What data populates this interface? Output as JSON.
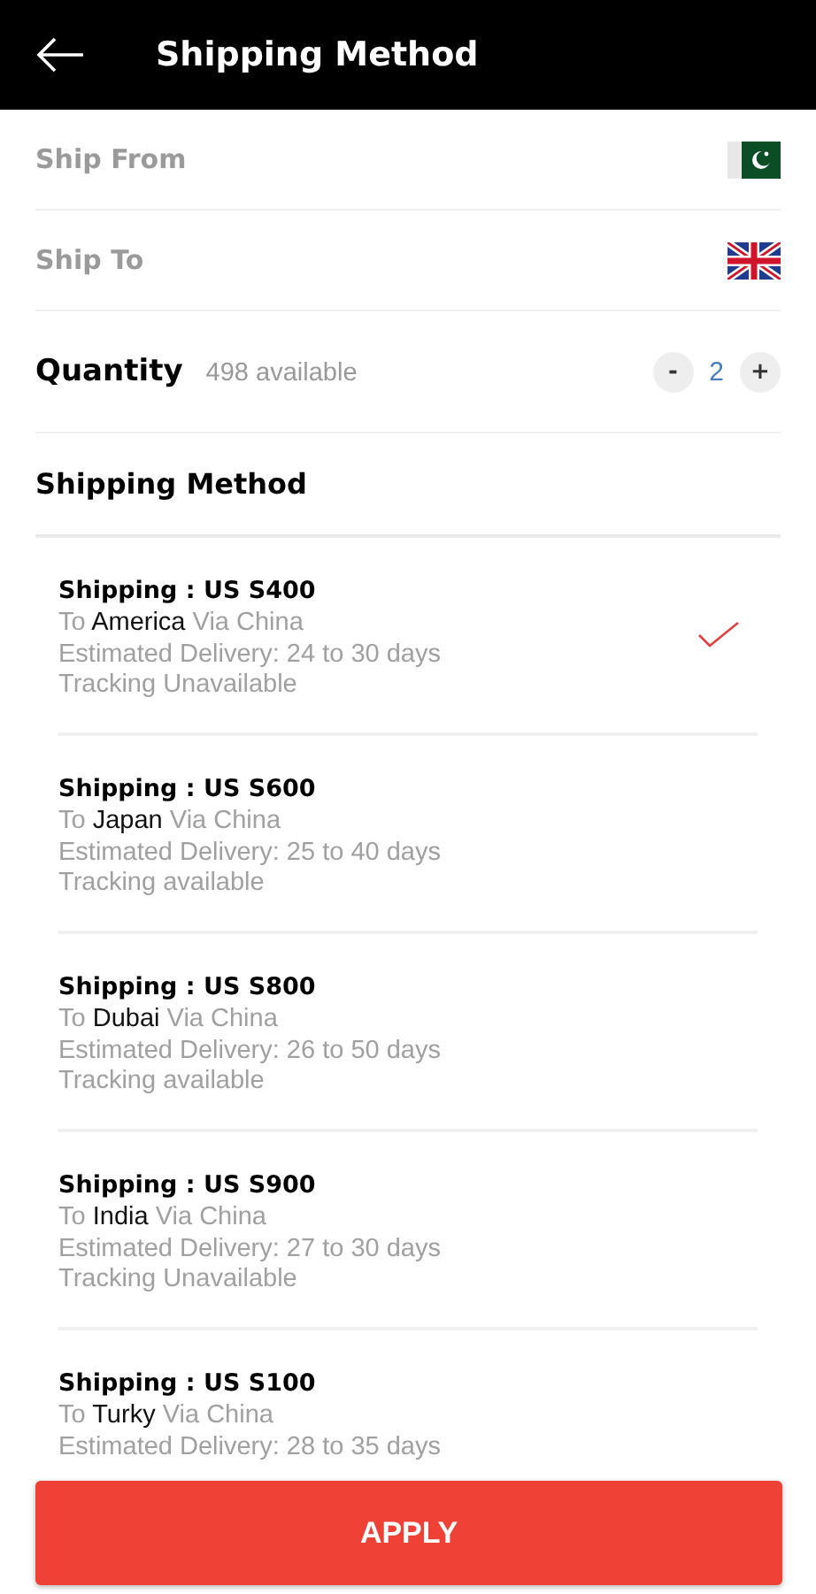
{
  "header": {
    "title": "Shipping Method"
  },
  "ship_from": {
    "label": "Ship From"
  },
  "ship_to": {
    "label": "Ship To"
  },
  "quantity": {
    "label": "Quantity",
    "available": "498 available",
    "minus": "-",
    "value": "2",
    "plus": "+"
  },
  "section_title": "Shipping Method",
  "options": [
    {
      "price": "Shipping : US S400",
      "to": "To",
      "place": "America",
      "via": "Via China",
      "delivery": "Estimated Delivery: 24 to 30 days",
      "tracking": "Tracking Unavailable",
      "selected": true
    },
    {
      "price": "Shipping : US S600",
      "to": "To",
      "place": "Japan",
      "via": "Via China",
      "delivery": "Estimated Delivery: 25 to 40 days",
      "tracking": "Tracking available",
      "selected": false
    },
    {
      "price": "Shipping : US S800",
      "to": "To",
      "place": "Dubai",
      "via": "Via China",
      "delivery": "Estimated Delivery: 26 to 50 days",
      "tracking": "Tracking available",
      "selected": false
    },
    {
      "price": "Shipping : US S900",
      "to": "To",
      "place": "India",
      "via": "Via China",
      "delivery": "Estimated Delivery: 27 to 30 days",
      "tracking": "Tracking Unavailable",
      "selected": false
    },
    {
      "price": "Shipping : US S100",
      "to": "To",
      "place": "Turky",
      "via": "Via China",
      "delivery": "Estimated Delivery: 28 to 35 days",
      "selected": false
    }
  ],
  "apply_button": "APPLY"
}
